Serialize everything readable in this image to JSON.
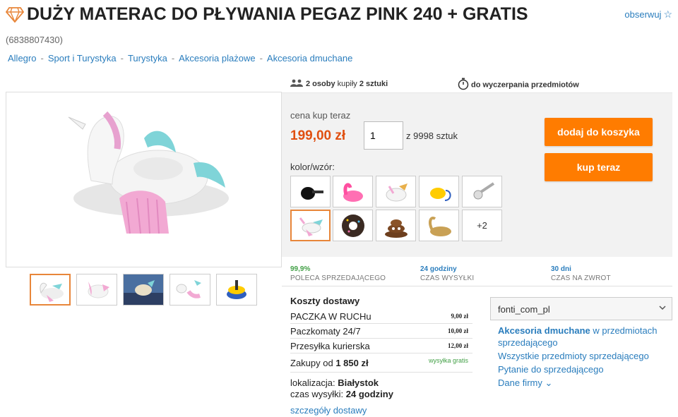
{
  "title": "DUŻY MATERAC DO PŁYWANIA PEGAZ PINK 240 + GRATIS",
  "item_id": "(6838807430)",
  "watch_label": "obserwuj",
  "breadcrumb": [
    "Allegro",
    "Sport i Turystyka",
    "Turystyka",
    "Akcesoria plażowe",
    "Akcesoria dmuchane"
  ],
  "buyers": {
    "count": "2 osoby",
    "verb": "kupiły",
    "qty": "2 sztuki"
  },
  "timer_text": "do wyczerpania przedmiotów",
  "purchase": {
    "price_label": "cena kup teraz",
    "price": "199,00 zł",
    "qty_value": "1",
    "qty_of": "z 9998 sztuk",
    "add_to_cart": "dodaj do koszyka",
    "buy_now": "kup teraz",
    "variant_label": "kolor/wzór:",
    "more_variants": "+2"
  },
  "stats": [
    {
      "value": "99,9%",
      "label": "POLECA SPRZEDAJĄCEGO"
    },
    {
      "value": "24 godziny",
      "label": "CZAS WYSYŁKI"
    },
    {
      "value": "30 dni",
      "label": "CZAS NA ZWROT"
    }
  ],
  "shipping": {
    "title": "Koszty dostawy",
    "rows": [
      {
        "name": "PACZKA W RUCHu",
        "cost": "9,00 zł"
      },
      {
        "name": "Paczkomaty 24/7",
        "cost": "10,00 zł"
      },
      {
        "name": "Przesyłka kurierska",
        "cost": "12,00 zł"
      }
    ],
    "free_prefix": "Zakupy od",
    "free_amount": "1 850 zł",
    "free_label": "wysyłka gratis",
    "location_label": "lokalizacja:",
    "location": "Białystok",
    "dispatch_label": "czas wysyłki:",
    "dispatch": "24 godziny",
    "details_link": "szczegóły dostawy"
  },
  "seller": {
    "name": "fonti_com_pl",
    "category_link": "Akcesoria dmuchane",
    "category_suffix": " w przedmiotach sprzedającego",
    "all_items": "Wszystkie przedmioty sprzedającego",
    "ask": "Pytanie do sprzedającego",
    "company": "Dane firmy"
  },
  "colors": {
    "accent_orange": "#ff7c00",
    "price_red": "#e04f10",
    "link_blue": "#2a7dbd",
    "green": "#43a047"
  }
}
